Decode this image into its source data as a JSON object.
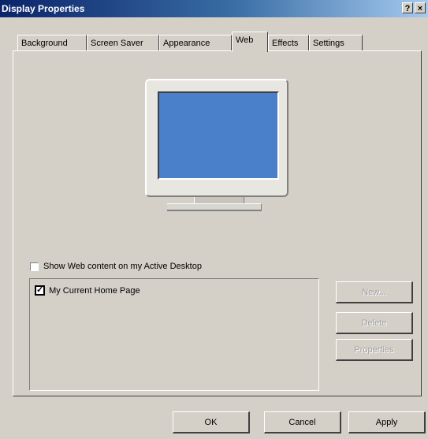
{
  "window": {
    "title": "Display Properties"
  },
  "title_buttons": {
    "help": "?",
    "close": "×"
  },
  "tabs": [
    {
      "label": "Background",
      "active": false
    },
    {
      "label": "Screen Saver",
      "active": false
    },
    {
      "label": "Appearance",
      "active": false
    },
    {
      "label": "Web",
      "active": true
    },
    {
      "label": "Effects",
      "active": false
    },
    {
      "label": "Settings",
      "active": false
    }
  ],
  "web_tab": {
    "show_web_content": {
      "label": "Show Web content on my Active Desktop",
      "checked": false
    },
    "list": {
      "items": [
        {
          "label": "My Current Home Page",
          "checked": true
        }
      ]
    },
    "buttons": {
      "new": "New...",
      "delete": "Delete",
      "properties": "Properties"
    }
  },
  "dialog_buttons": {
    "ok": "OK",
    "cancel": "Cancel",
    "apply": "Apply"
  },
  "colors": {
    "title_bar_start": "#0a246a",
    "title_bar_end": "#a6caf0",
    "face": "#d4d0c8",
    "monitor_screen": "#4a7fc9"
  }
}
